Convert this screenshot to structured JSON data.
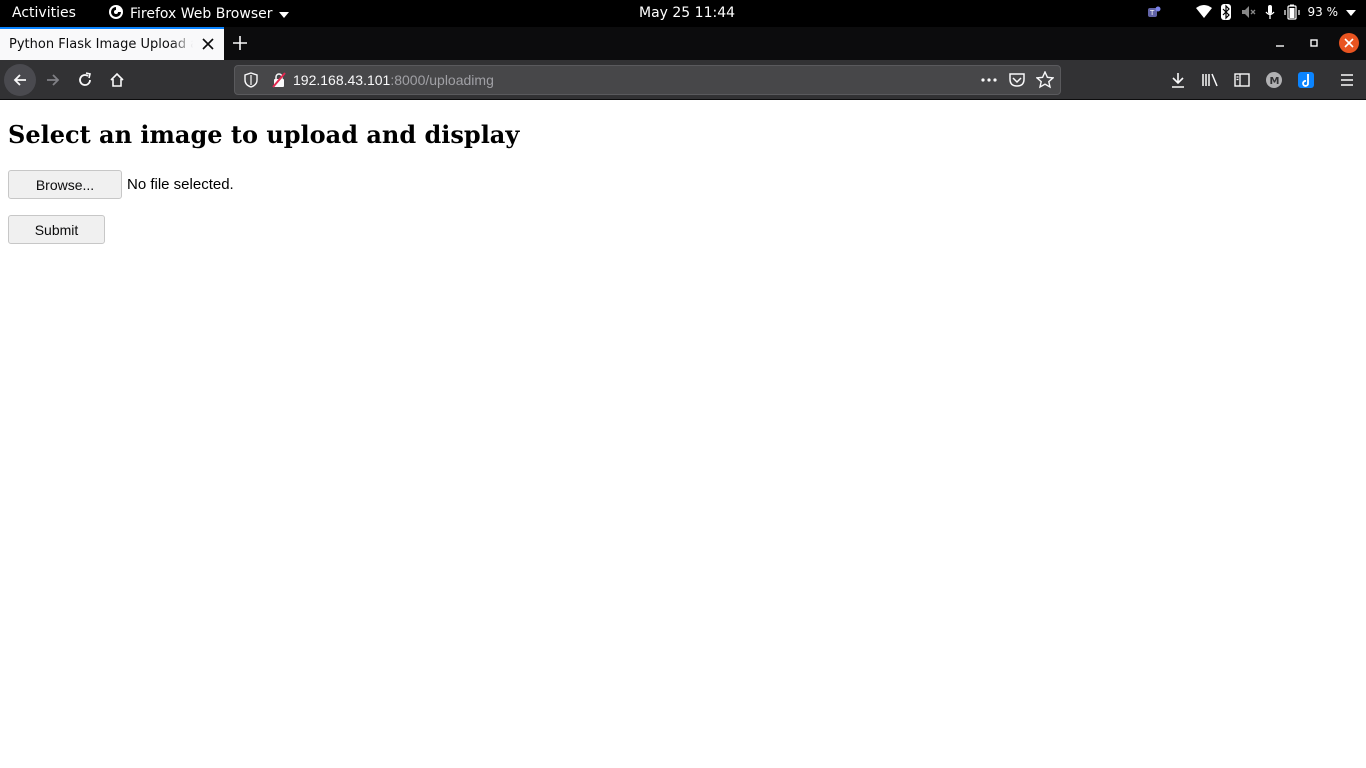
{
  "topbar": {
    "activities": "Activities",
    "app_name": "Firefox Web Browser",
    "clock": "May 25  11:44",
    "battery": "93 %"
  },
  "browser": {
    "tab_title": "Python Flask Image Upload and Display",
    "url_host": "192.168.43.101",
    "url_path": ":8000/uploadimg"
  },
  "page": {
    "heading": "Select an image to upload and display",
    "browse_label": "Browse...",
    "file_status": "No file selected.",
    "submit_label": "Submit"
  },
  "colors": {
    "tab_accent": "#0a84ff",
    "close_button": "#e95420",
    "navbar_bg": "#323234"
  },
  "icons": [
    "firefox-icon",
    "teams-icon",
    "wifi-icon",
    "bluetooth-icon",
    "volume-muted-icon",
    "microphone-icon",
    "battery-icon",
    "library-icon",
    "sidebar-icon",
    "account-icon",
    "extension-icon",
    "hamburger-menu-icon"
  ]
}
